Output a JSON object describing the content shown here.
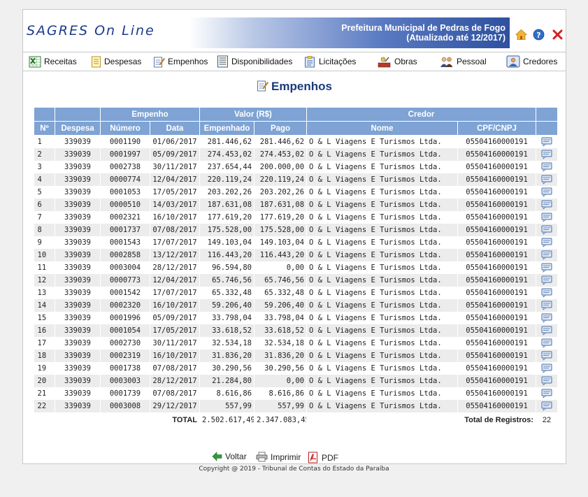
{
  "header": {
    "logo": "SAGRES On Line",
    "org": "Prefeitura Municipal de Pedras de Fogo",
    "updated": "(Atualizado até 12/2017)",
    "icons": [
      "home-icon",
      "help-icon",
      "close-icon"
    ]
  },
  "menu": [
    {
      "label": "Receitas",
      "icon": "spreadsheet-icon"
    },
    {
      "label": "Despesas",
      "icon": "document-icon"
    },
    {
      "label": "Empenhos",
      "icon": "edit-document-icon"
    },
    {
      "label": "Disponibilidades",
      "icon": "ledger-icon"
    },
    {
      "label": "Licitações",
      "icon": "clipboard-icon"
    },
    {
      "label": "Obras",
      "icon": "construction-icon"
    },
    {
      "label": "Pessoal",
      "icon": "people-icon"
    },
    {
      "label": "Credores",
      "icon": "person-card-icon"
    }
  ],
  "page_title": "Empenhos",
  "table": {
    "group_headers": {
      "empenho": "Empenho",
      "valor": "Valor (R$)",
      "credor": "Credor"
    },
    "columns": [
      "Nº",
      "Despesa",
      "Número",
      "Data",
      "Empenhado",
      "Pago",
      "Nome",
      "CPF/CNPJ"
    ],
    "rows": [
      [
        "1",
        "339039",
        "0001190",
        "01/06/2017",
        "281.446,62",
        "281.446,62",
        "O & L Viagens E Turismos Ltda.",
        "05504160000191"
      ],
      [
        "2",
        "339039",
        "0001997",
        "05/09/2017",
        "274.453,02",
        "274.453,02",
        "O & L Viagens E Turismos Ltda.",
        "05504160000191"
      ],
      [
        "3",
        "339039",
        "0002738",
        "30/11/2017",
        "237.654,44",
        "200.000,00",
        "O & L Viagens E Turismos Ltda.",
        "05504160000191"
      ],
      [
        "4",
        "339039",
        "0000774",
        "12/04/2017",
        "220.119,24",
        "220.119,24",
        "O & L Viagens E Turismos Ltda.",
        "05504160000191"
      ],
      [
        "5",
        "339039",
        "0001053",
        "17/05/2017",
        "203.202,26",
        "203.202,26",
        "O & L Viagens E Turismos Ltda.",
        "05504160000191"
      ],
      [
        "6",
        "339039",
        "0000510",
        "14/03/2017",
        "187.631,08",
        "187.631,08",
        "O & L Viagens E Turismos Ltda.",
        "05504160000191"
      ],
      [
        "7",
        "339039",
        "0002321",
        "16/10/2017",
        "177.619,20",
        "177.619,20",
        "O & L Viagens E Turismos Ltda.",
        "05504160000191"
      ],
      [
        "8",
        "339039",
        "0001737",
        "07/08/2017",
        "175.528,00",
        "175.528,00",
        "O & L Viagens E Turismos Ltda.",
        "05504160000191"
      ],
      [
        "9",
        "339039",
        "0001543",
        "17/07/2017",
        "149.103,04",
        "149.103,04",
        "O & L Viagens E Turismos Ltda.",
        "05504160000191"
      ],
      [
        "10",
        "339039",
        "0002858",
        "13/12/2017",
        "116.443,20",
        "116.443,20",
        "O & L Viagens E Turismos Ltda.",
        "05504160000191"
      ],
      [
        "11",
        "339039",
        "0003004",
        "28/12/2017",
        "96.594,80",
        "0,00",
        "O & L Viagens E Turismos Ltda.",
        "05504160000191"
      ],
      [
        "12",
        "339039",
        "0000773",
        "12/04/2017",
        "65.746,56",
        "65.746,56",
        "O & L Viagens E Turismos Ltda.",
        "05504160000191"
      ],
      [
        "13",
        "339039",
        "0001542",
        "17/07/2017",
        "65.332,48",
        "65.332,48",
        "O & L Viagens E Turismos Ltda.",
        "05504160000191"
      ],
      [
        "14",
        "339039",
        "0002320",
        "16/10/2017",
        "59.206,40",
        "59.206,40",
        "O & L Viagens E Turismos Ltda.",
        "05504160000191"
      ],
      [
        "15",
        "339039",
        "0001996",
        "05/09/2017",
        "33.798,04",
        "33.798,04",
        "O & L Viagens E Turismos Ltda.",
        "05504160000191"
      ],
      [
        "16",
        "339039",
        "0001054",
        "17/05/2017",
        "33.618,52",
        "33.618,52",
        "O & L Viagens E Turismos Ltda.",
        "05504160000191"
      ],
      [
        "17",
        "339039",
        "0002730",
        "30/11/2017",
        "32.534,18",
        "32.534,18",
        "O & L Viagens E Turismos Ltda.",
        "05504160000191"
      ],
      [
        "18",
        "339039",
        "0002319",
        "16/10/2017",
        "31.836,20",
        "31.836,20",
        "O & L Viagens E Turismos Ltda.",
        "05504160000191"
      ],
      [
        "19",
        "339039",
        "0001738",
        "07/08/2017",
        "30.290,56",
        "30.290,56",
        "O & L Viagens E Turismos Ltda.",
        "05504160000191"
      ],
      [
        "20",
        "339039",
        "0003003",
        "28/12/2017",
        "21.284,80",
        "0,00",
        "O & L Viagens E Turismos Ltda.",
        "05504160000191"
      ],
      [
        "21",
        "339039",
        "0001739",
        "07/08/2017",
        "8.616,86",
        "8.616,86",
        "O & L Viagens E Turismos Ltda.",
        "05504160000191"
      ],
      [
        "22",
        "339039",
        "0003008",
        "29/12/2017",
        "557,99",
        "557,99",
        "O & L Viagens E Turismos Ltda.",
        "05504160000191"
      ]
    ],
    "total_label": "TOTAL",
    "total_empenhado": "2.502.617,49",
    "total_pago": "2.347.083,45",
    "registros_label": "Total de Registros:",
    "registros_count": "22"
  },
  "actions": {
    "voltar": "Voltar",
    "imprimir": "Imprimir",
    "pdf": "PDF"
  },
  "footer": {
    "copyright": "Copyright @ 2019 - Tribunal de Contas do Estado da Paraíba"
  }
}
